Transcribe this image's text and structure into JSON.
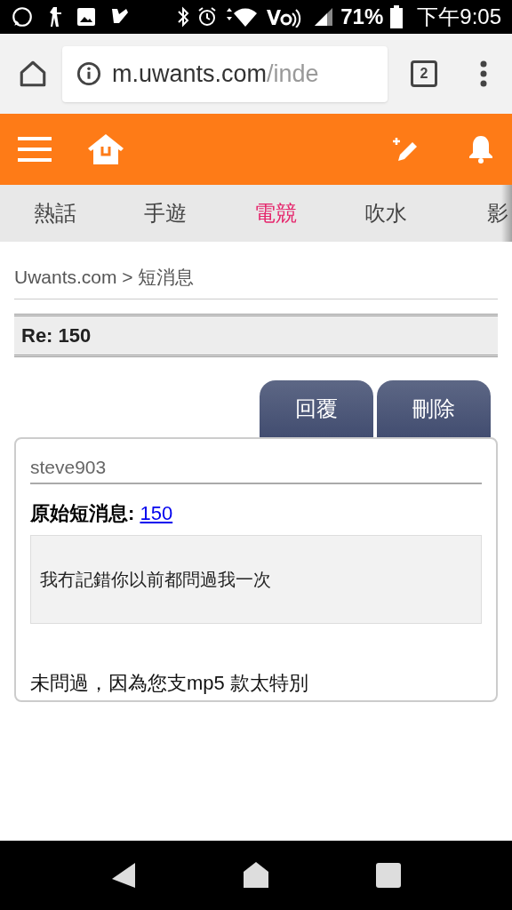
{
  "status_bar": {
    "battery": "71%",
    "time": "下午9:05"
  },
  "browser": {
    "url_host": "m.uwants.com",
    "url_path": "/inde",
    "tab_count": "2"
  },
  "tabs": [
    {
      "label": "熱話",
      "selected": false
    },
    {
      "label": "手遊",
      "selected": false
    },
    {
      "label": "電競",
      "selected": true
    },
    {
      "label": "吹水",
      "selected": false
    },
    {
      "label": "影",
      "selected": false
    }
  ],
  "breadcrumb": "Uwants.com > 短消息",
  "title": "Re: 150",
  "buttons": [
    "回覆",
    "刪除"
  ],
  "message": {
    "sender": "steve903",
    "original_label": "原始短消息:",
    "original_link": "150",
    "quote": "我冇記錯你以前都問過我一次",
    "body": "未問過，因為您支mp5 款太特別"
  }
}
